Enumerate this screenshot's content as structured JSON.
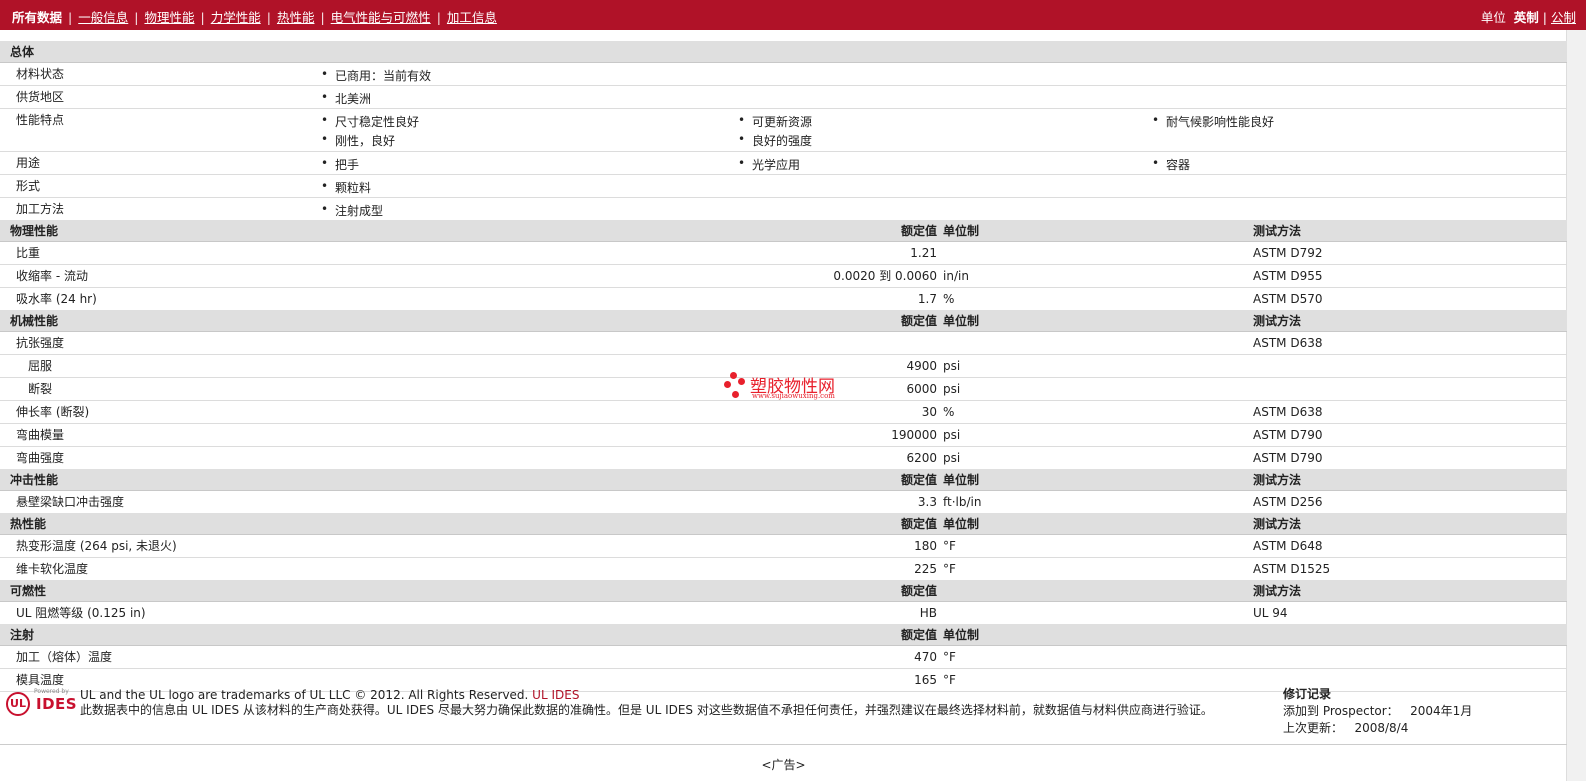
{
  "nav": {
    "tabs": [
      {
        "label": "所有数据",
        "active": true
      },
      {
        "label": "一般信息"
      },
      {
        "label": "物理性能"
      },
      {
        "label": "力学性能"
      },
      {
        "label": "热性能"
      },
      {
        "label": "电气性能与可燃性"
      },
      {
        "label": "加工信息"
      }
    ],
    "units_label": "单位",
    "unit_english": "英制",
    "unit_metric": "公制"
  },
  "columns": {
    "nominal": "额定值",
    "unit": "单位制",
    "method": "测试方法"
  },
  "general": {
    "title": "总体",
    "rows": [
      {
        "label": "材料状态",
        "items": [
          "已商用：当前有效"
        ]
      },
      {
        "label": "供货地区",
        "items": [
          "北美洲"
        ]
      },
      {
        "label": "性能特点",
        "items": [
          "尺寸稳定性良好",
          "可更新资源",
          "耐气候影响性能良好",
          "刚性，良好",
          "良好的强度"
        ]
      },
      {
        "label": "用途",
        "items": [
          "把手",
          "光学应用",
          "容器"
        ]
      },
      {
        "label": "形式",
        "items": [
          "颗粒料"
        ]
      },
      {
        "label": "加工方法",
        "items": [
          "注射成型"
        ]
      }
    ]
  },
  "physical": {
    "title": "物理性能",
    "rows": [
      {
        "label": "比重",
        "value": "1.21",
        "unit": "",
        "method": "ASTM D792"
      },
      {
        "label": "收缩率  - 流动",
        "value": "0.0020 到  0.0060",
        "unit": "in/in",
        "method": "ASTM D955"
      },
      {
        "label": "吸水率 (24 hr)",
        "value": "1.7",
        "unit": "%",
        "method": "ASTM D570"
      }
    ]
  },
  "mechanical": {
    "title": "机械性能",
    "rows": [
      {
        "label": "抗张强度",
        "value": "",
        "unit": "",
        "method": "ASTM D638"
      },
      {
        "label": "屈服",
        "value": "4900",
        "unit": "psi",
        "method": "",
        "sub": true
      },
      {
        "label": "断裂",
        "value": "6000",
        "unit": "psi",
        "method": "",
        "sub": true
      },
      {
        "label": "伸长率 (断裂)",
        "value": "30",
        "unit": "%",
        "method": "ASTM D638"
      },
      {
        "label": "弯曲模量",
        "value": "190000",
        "unit": "psi",
        "method": "ASTM D790"
      },
      {
        "label": "弯曲强度",
        "value": "6200",
        "unit": "psi",
        "method": "ASTM D790"
      }
    ]
  },
  "impact": {
    "title": "冲击性能",
    "rows": [
      {
        "label": "悬壁梁缺口冲击强度",
        "value": "3.3",
        "unit": "ft·lb/in",
        "method": "ASTM D256"
      }
    ]
  },
  "thermal": {
    "title": "热性能",
    "rows": [
      {
        "label": "热变形温度 (264 psi, 未退火)",
        "value": "180",
        "unit": "°F",
        "method": "ASTM D648"
      },
      {
        "label": "维卡软化温度",
        "value": "225",
        "unit": "°F",
        "method": "ASTM D1525"
      }
    ]
  },
  "flammability": {
    "title": "可燃性",
    "rows": [
      {
        "label": "UL 阻燃等级 (0.125 in)",
        "value": "HB",
        "unit": "",
        "method": "UL 94"
      }
    ]
  },
  "injection": {
    "title": "注射",
    "rows": [
      {
        "label": "加工（熔体）温度",
        "value": "470",
        "unit": "°F",
        "method": ""
      },
      {
        "label": "模具温度",
        "value": "165",
        "unit": "°F",
        "method": ""
      }
    ]
  },
  "watermark": {
    "cn": "塑胶物性网",
    "url": "www.sujiaowuxing.com"
  },
  "footer": {
    "logo_powered": "Powered by",
    "logo_ul": "UL",
    "logo_ides": "IDES",
    "trademark_prefix": "UL and the UL logo are trademarks of UL LLC © 2012. All Rights Reserved. ",
    "trademark_link": "UL IDES",
    "disclaimer": "此数据表中的信息由 UL IDES 从该材料的生产商处获得。UL IDES 尽最大努力确保此数据的准确性。但是 UL IDES 对这些数据值不承担任何责任，并强烈建议在最终选择材料前，就数据值与材料供应商进行验证。",
    "revision_title": "修订记录",
    "added_label": "添加到 Prospector：",
    "added_value": "2004年1月",
    "updated_label": "上次更新：",
    "updated_value": "2008/8/4"
  },
  "ad": "<广告>"
}
